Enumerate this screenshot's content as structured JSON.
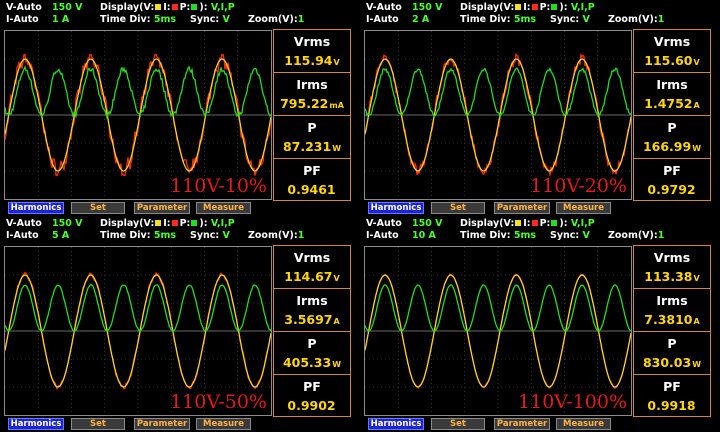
{
  "labels": {
    "v_auto": "V-Auto",
    "i_auto": "I-Auto",
    "display": "Display(",
    "v_key": "V:",
    "i_key": "I:",
    "p_key": "P:",
    "close": "):",
    "time_div": "Time Div:",
    "sync": "Sync:",
    "zoom": "Zoom(V):"
  },
  "colors": {
    "voltage": "#f0e020",
    "current": "#ff2a1a",
    "power": "#22dd22",
    "accent": "#4cff2e",
    "value": "#ffd60a"
  },
  "buttons": [
    "Harmonics",
    "Set",
    "Parameter",
    "Measure"
  ],
  "panels": [
    {
      "v_range": "150 V",
      "i_range": "1 A",
      "display_mode": "V,I,P",
      "time_div": "5ms",
      "sync": "V",
      "zoom": "1",
      "caption": "110V-10%",
      "measurements": [
        {
          "label": "Vrms",
          "value": "115.94",
          "unit": "V"
        },
        {
          "label": "Irms",
          "value": "795.22",
          "unit": "mA"
        },
        {
          "label": "P",
          "value": "87.231",
          "unit": "W"
        },
        {
          "label": "PF",
          "value": "0.9461",
          "unit": ""
        }
      ]
    },
    {
      "v_range": "150 V",
      "i_range": "2 A",
      "display_mode": "V,I,P",
      "time_div": "5ms",
      "sync": "V",
      "zoom": "1",
      "caption": "110V-20%",
      "measurements": [
        {
          "label": "Vrms",
          "value": "115.60",
          "unit": "V"
        },
        {
          "label": "Irms",
          "value": "1.4752",
          "unit": "A"
        },
        {
          "label": "P",
          "value": "166.99",
          "unit": "W"
        },
        {
          "label": "PF",
          "value": "0.9792",
          "unit": ""
        }
      ]
    },
    {
      "v_range": "150 V",
      "i_range": "5 A",
      "display_mode": "V,I,P",
      "time_div": "5ms",
      "sync": "V",
      "zoom": "1",
      "caption": "110V-50%",
      "measurements": [
        {
          "label": "Vrms",
          "value": "114.67",
          "unit": "V"
        },
        {
          "label": "Irms",
          "value": "3.5697",
          "unit": "A"
        },
        {
          "label": "P",
          "value": "405.33",
          "unit": "W"
        },
        {
          "label": "PF",
          "value": "0.9902",
          "unit": ""
        }
      ]
    },
    {
      "v_range": "150 V",
      "i_range": "10 A",
      "display_mode": "V,I,P",
      "time_div": "5ms",
      "sync": "V",
      "zoom": "1",
      "caption": "110V-100%",
      "measurements": [
        {
          "label": "Vrms",
          "value": "113.38",
          "unit": "V"
        },
        {
          "label": "Irms",
          "value": "7.3810",
          "unit": "A"
        },
        {
          "label": "P",
          "value": "830.03",
          "unit": "W"
        },
        {
          "label": "PF",
          "value": "0.9918",
          "unit": ""
        }
      ]
    }
  ]
}
